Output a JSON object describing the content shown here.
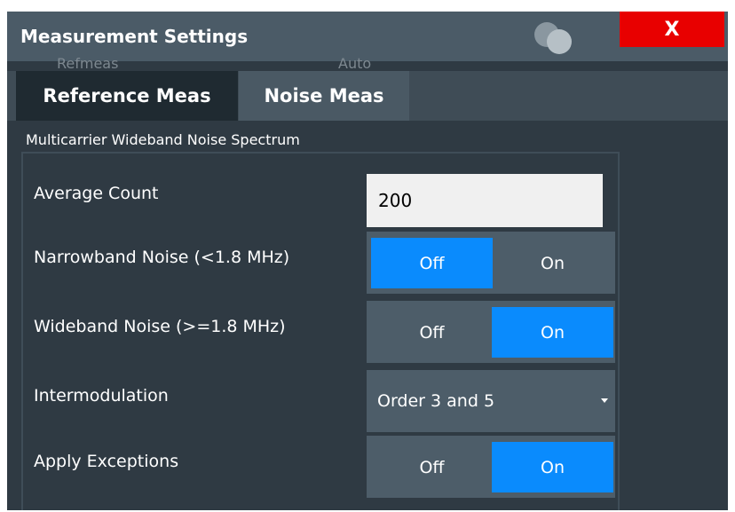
{
  "dialog": {
    "title": "Measurement Settings",
    "close_label": "X",
    "background_ghost_text": [
      "Refmeas",
      "Auto"
    ]
  },
  "tabs": [
    {
      "label": "Reference Meas",
      "selected": false
    },
    {
      "label": "Noise Meas",
      "selected": true
    }
  ],
  "section": {
    "label": "Multicarrier Wideband Noise Spectrum"
  },
  "fields": {
    "average_count": {
      "label": "Average Count",
      "value": "200"
    },
    "narrowband_noise": {
      "label": "Narrowband Noise (<1.8 MHz)",
      "off_label": "Off",
      "on_label": "On",
      "selected": "Off"
    },
    "wideband_noise": {
      "label": "Wideband Noise (>=1.8 MHz)",
      "off_label": "Off",
      "on_label": "On",
      "selected": "On"
    },
    "intermodulation": {
      "label": "Intermodulation",
      "value": "Order 3 and 5"
    },
    "apply_exceptions": {
      "label": "Apply Exceptions",
      "off_label": "Off",
      "on_label": "On",
      "selected": "On"
    }
  },
  "colors": {
    "active_toggle": "#0a8bfd",
    "close_button": "#e80000",
    "title_bar": "#4b5b67",
    "dialog_background": "#2f3a43"
  }
}
